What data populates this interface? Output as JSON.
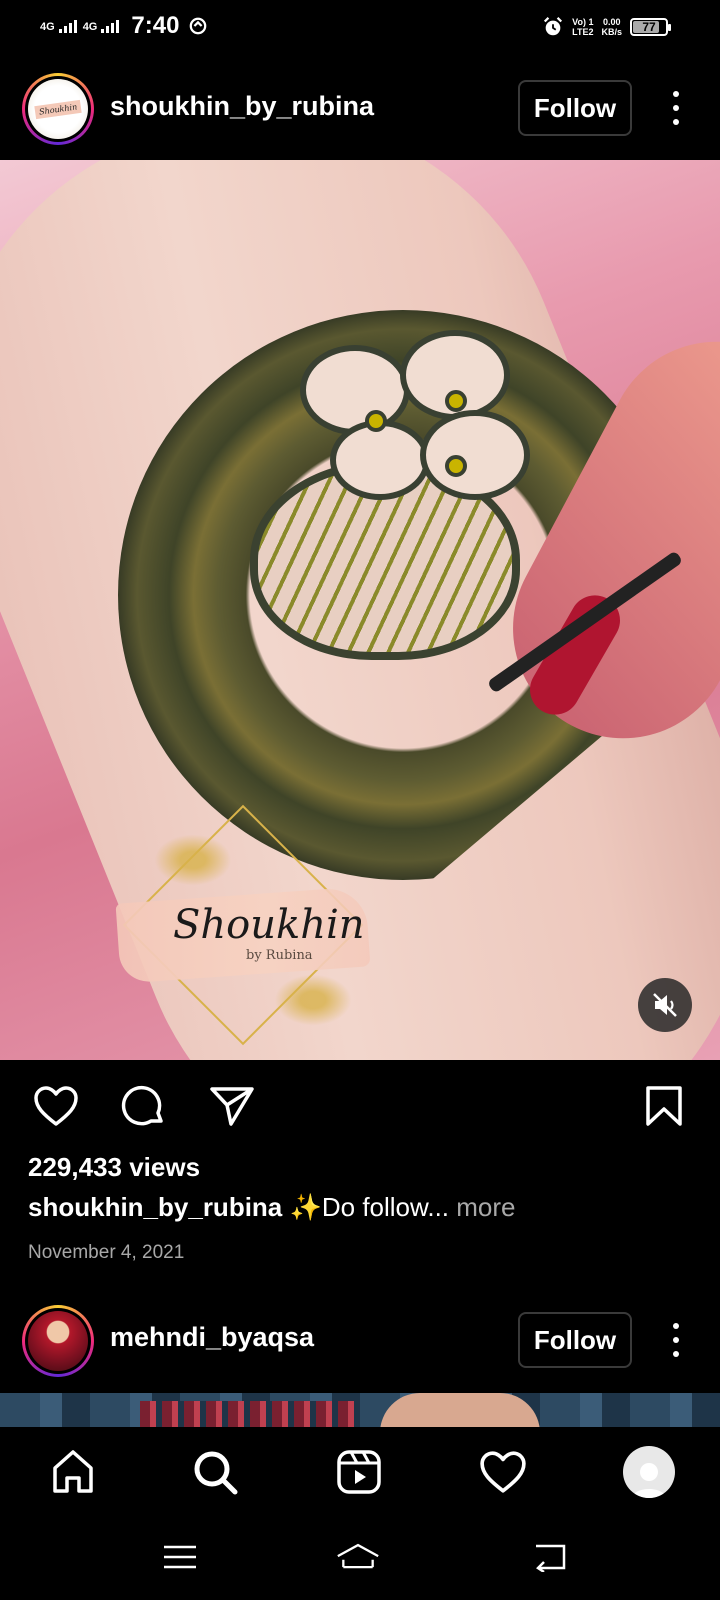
{
  "status_bar": {
    "net1": "4G",
    "net2": "4G",
    "time": "7:40",
    "volte_top": "Vo) 1",
    "volte_bottom": "LTE2",
    "speed_top": "0.00",
    "speed_bottom": "KB/s",
    "battery": "77",
    "battery_level": 0.77
  },
  "post1": {
    "username": "shoukhin_by_rubina",
    "avatar_badge": "Shoukhin",
    "follow_label": "Follow",
    "watermark_title": "Shoukhin",
    "watermark_sub": "by Rubina",
    "views": "229,433 views",
    "caption_user": "shoukhin_by_rubina",
    "caption_text": " ✨Do follow...",
    "caption_more": " more",
    "date": "November 4, 2021"
  },
  "post2": {
    "username": "mehndi_byaqsa",
    "follow_label": "Follow"
  },
  "icons": {
    "like": "heart-icon",
    "comment": "comment-icon",
    "share": "send-icon",
    "save": "bookmark-icon",
    "mute": "speaker-muted-icon"
  },
  "bottom_nav": [
    "home",
    "search",
    "reels",
    "activity",
    "profile"
  ],
  "colors": {
    "background": "#000000",
    "text": "#ffffff",
    "secondary_text": "#a8a8a8",
    "button_border": "#3a3a3a"
  }
}
